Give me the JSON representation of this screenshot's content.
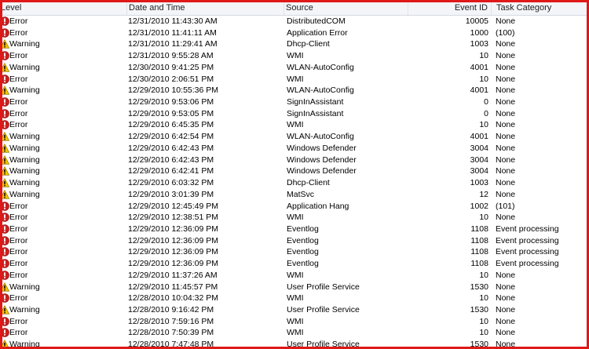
{
  "columns": {
    "level": "Level",
    "date": "Date and Time",
    "source": "Source",
    "event_id": "Event ID",
    "task": "Task Category"
  },
  "colors": {
    "frame": "#e01818",
    "error": "#cc1f1f",
    "warning": "#f2c200"
  },
  "rows": [
    {
      "level": "Error",
      "icon": "error-icon",
      "date": "12/31/2010 11:43:30 AM",
      "source": "DistributedCOM",
      "event_id": "10005",
      "task": "None"
    },
    {
      "level": "Error",
      "icon": "error-icon",
      "date": "12/31/2010 11:41:11 AM",
      "source": "Application Error",
      "event_id": "1000",
      "task": "(100)"
    },
    {
      "level": "Warning",
      "icon": "warning-icon",
      "date": "12/31/2010 11:29:41 AM",
      "source": "Dhcp-Client",
      "event_id": "1003",
      "task": "None"
    },
    {
      "level": "Error",
      "icon": "error-icon",
      "date": "12/31/2010 9:55:28 AM",
      "source": "WMI",
      "event_id": "10",
      "task": "None"
    },
    {
      "level": "Warning",
      "icon": "warning-icon",
      "date": "12/30/2010 9:41:25 PM",
      "source": "WLAN-AutoConfig",
      "event_id": "4001",
      "task": "None"
    },
    {
      "level": "Error",
      "icon": "error-icon",
      "date": "12/30/2010 2:06:51 PM",
      "source": "WMI",
      "event_id": "10",
      "task": "None"
    },
    {
      "level": "Warning",
      "icon": "warning-icon",
      "date": "12/29/2010 10:55:36 PM",
      "source": "WLAN-AutoConfig",
      "event_id": "4001",
      "task": "None"
    },
    {
      "level": "Error",
      "icon": "error-icon",
      "date": "12/29/2010 9:53:06 PM",
      "source": "SignInAssistant",
      "event_id": "0",
      "task": "None"
    },
    {
      "level": "Error",
      "icon": "error-icon",
      "date": "12/29/2010 9:53:05 PM",
      "source": "SignInAssistant",
      "event_id": "0",
      "task": "None"
    },
    {
      "level": "Error",
      "icon": "error-icon",
      "date": "12/29/2010 6:45:35 PM",
      "source": "WMI",
      "event_id": "10",
      "task": "None"
    },
    {
      "level": "Warning",
      "icon": "warning-icon",
      "date": "12/29/2010 6:42:54 PM",
      "source": "WLAN-AutoConfig",
      "event_id": "4001",
      "task": "None"
    },
    {
      "level": "Warning",
      "icon": "warning-icon",
      "date": "12/29/2010 6:42:43 PM",
      "source": "Windows Defender",
      "event_id": "3004",
      "task": "None"
    },
    {
      "level": "Warning",
      "icon": "warning-icon",
      "date": "12/29/2010 6:42:43 PM",
      "source": "Windows Defender",
      "event_id": "3004",
      "task": "None"
    },
    {
      "level": "Warning",
      "icon": "warning-icon",
      "date": "12/29/2010 6:42:41 PM",
      "source": "Windows Defender",
      "event_id": "3004",
      "task": "None"
    },
    {
      "level": "Warning",
      "icon": "warning-icon",
      "date": "12/29/2010 6:03:32 PM",
      "source": "Dhcp-Client",
      "event_id": "1003",
      "task": "None"
    },
    {
      "level": "Warning",
      "icon": "warning-icon",
      "date": "12/29/2010 3:01:39 PM",
      "source": "MatSvc",
      "event_id": "12",
      "task": "None"
    },
    {
      "level": "Error",
      "icon": "error-icon",
      "date": "12/29/2010 12:45:49 PM",
      "source": "Application Hang",
      "event_id": "1002",
      "task": "(101)"
    },
    {
      "level": "Error",
      "icon": "error-icon",
      "date": "12/29/2010 12:38:51 PM",
      "source": "WMI",
      "event_id": "10",
      "task": "None"
    },
    {
      "level": "Error",
      "icon": "error-icon",
      "date": "12/29/2010 12:36:09 PM",
      "source": "Eventlog",
      "event_id": "1108",
      "task": "Event processing"
    },
    {
      "level": "Error",
      "icon": "error-icon",
      "date": "12/29/2010 12:36:09 PM",
      "source": "Eventlog",
      "event_id": "1108",
      "task": "Event processing"
    },
    {
      "level": "Error",
      "icon": "error-icon",
      "date": "12/29/2010 12:36:09 PM",
      "source": "Eventlog",
      "event_id": "1108",
      "task": "Event processing"
    },
    {
      "level": "Error",
      "icon": "error-icon",
      "date": "12/29/2010 12:36:09 PM",
      "source": "Eventlog",
      "event_id": "1108",
      "task": "Event processing"
    },
    {
      "level": "Error",
      "icon": "error-icon",
      "date": "12/29/2010 11:37:26 AM",
      "source": "WMI",
      "event_id": "10",
      "task": "None"
    },
    {
      "level": "Warning",
      "icon": "warning-icon",
      "date": "12/29/2010 11:45:57 PM",
      "source": "User Profile Service",
      "event_id": "1530",
      "task": "None"
    },
    {
      "level": "Error",
      "icon": "error-icon",
      "date": "12/28/2010 10:04:32 PM",
      "source": "WMI",
      "event_id": "10",
      "task": "None"
    },
    {
      "level": "Warning",
      "icon": "warning-icon",
      "date": "12/28/2010 9:16:42 PM",
      "source": "User Profile Service",
      "event_id": "1530",
      "task": "None"
    },
    {
      "level": "Error",
      "icon": "error-icon",
      "date": "12/28/2010 7:59:16 PM",
      "source": "WMI",
      "event_id": "10",
      "task": "None"
    },
    {
      "level": "Error",
      "icon": "error-icon",
      "date": "12/28/2010 7:50:39 PM",
      "source": "WMI",
      "event_id": "10",
      "task": "None"
    },
    {
      "level": "Warning",
      "icon": "warning-icon",
      "date": "12/28/2010 7:47:48 PM",
      "source": "User Profile Service",
      "event_id": "1530",
      "task": "None"
    }
  ]
}
